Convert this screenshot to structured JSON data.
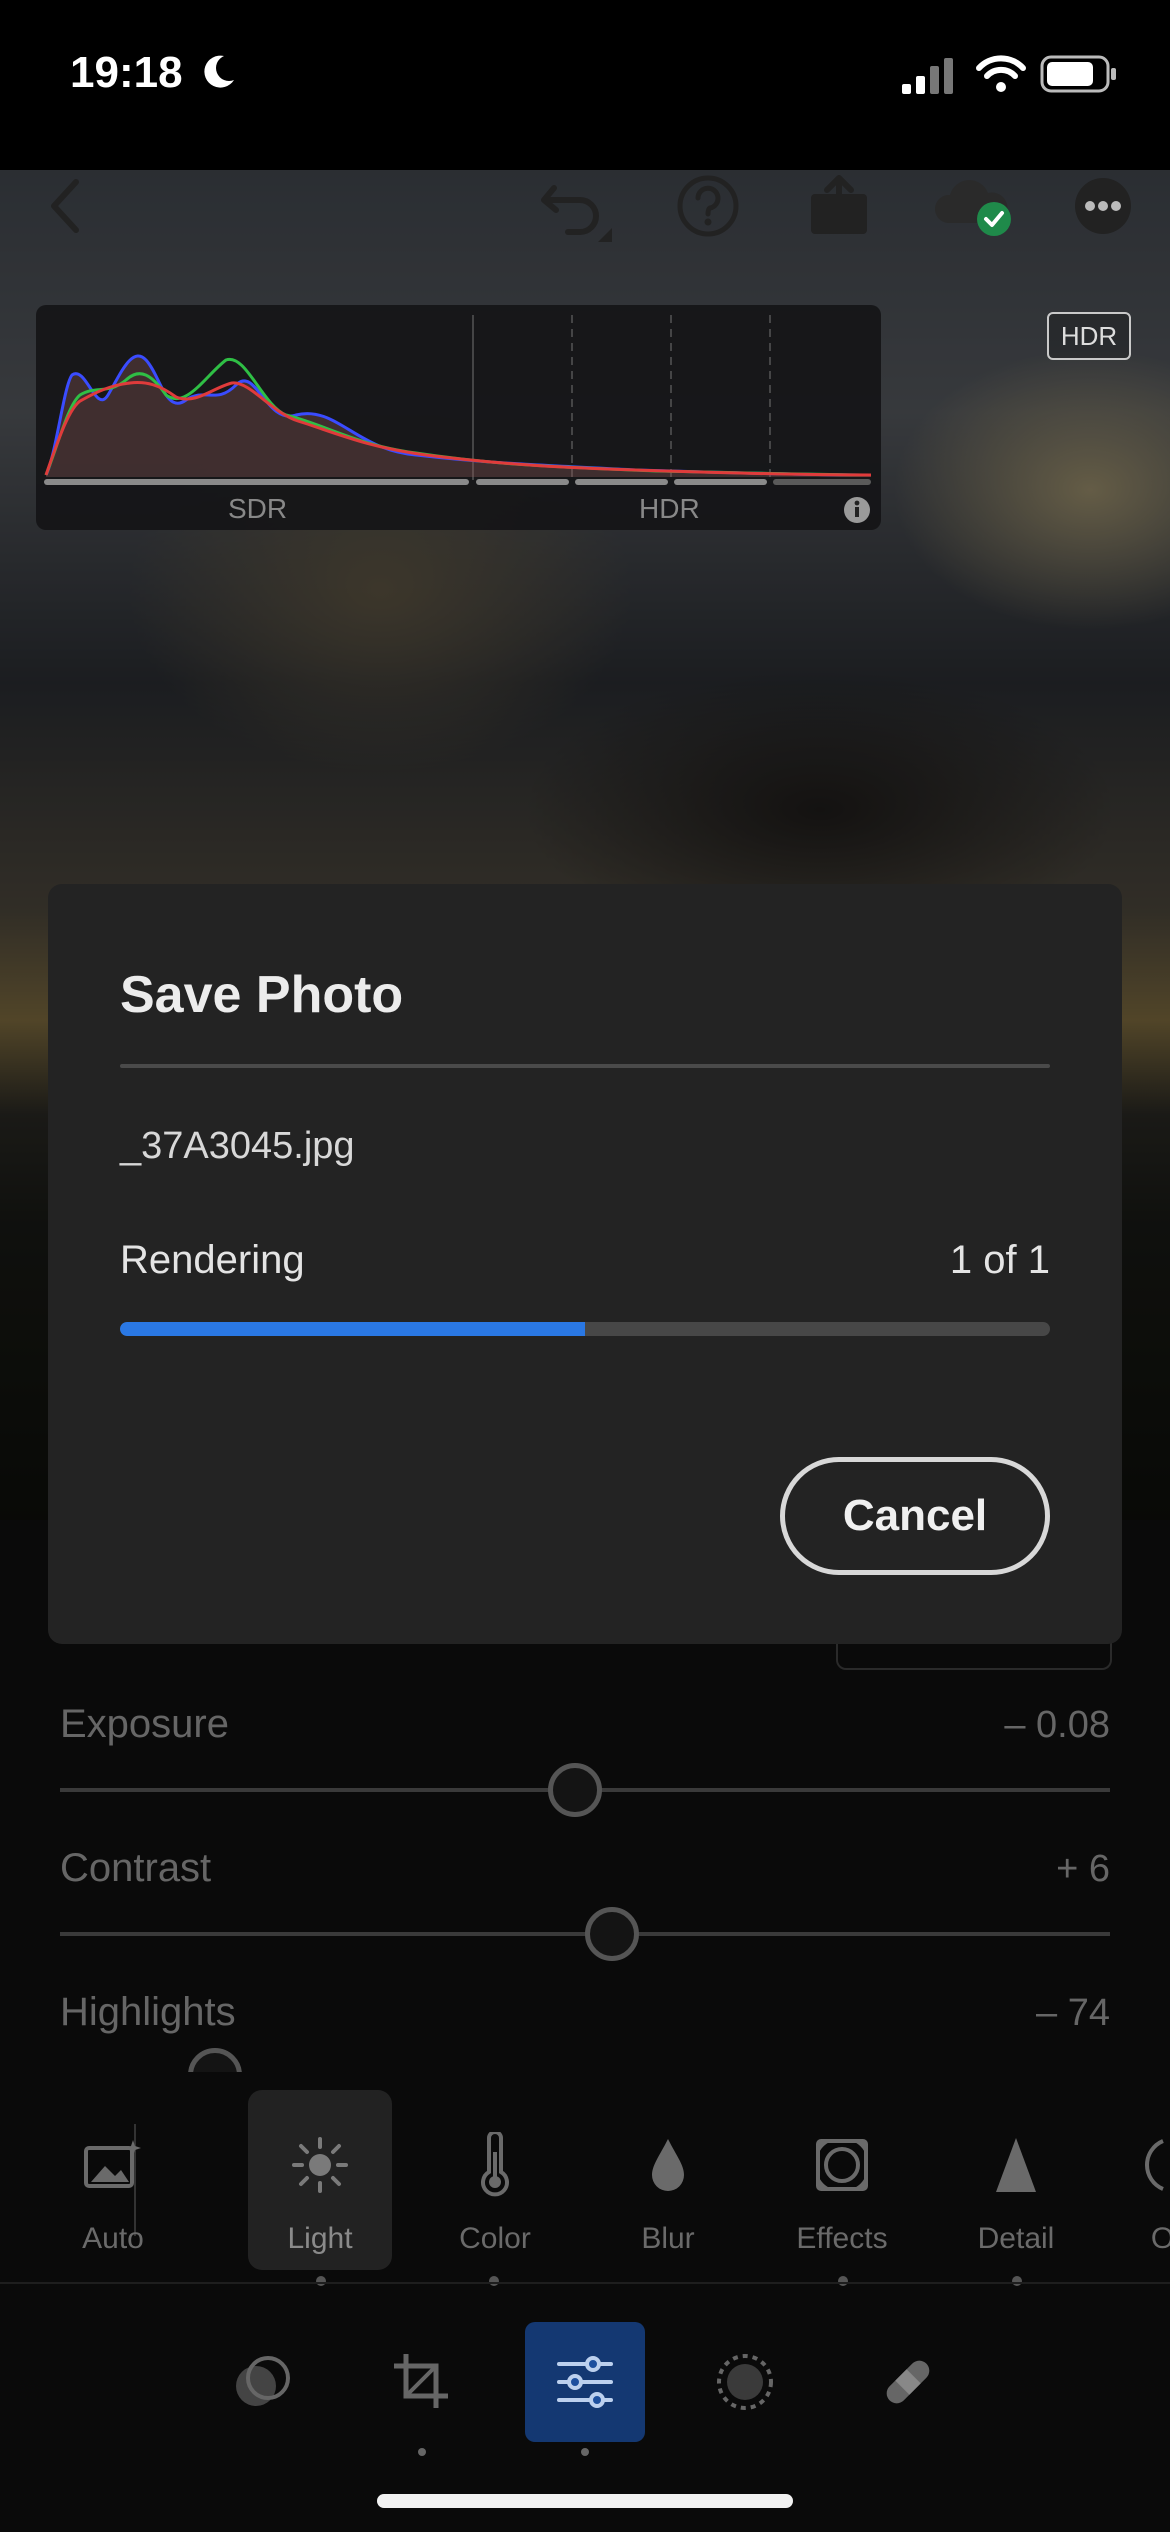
{
  "status_bar": {
    "time": "19:18"
  },
  "histogram": {
    "sdr_label": "SDR",
    "hdr_label": "HDR"
  },
  "hdr_badge": "HDR",
  "sliders": [
    {
      "label": "Exposure",
      "value": "– 0.08",
      "position": 0.49
    },
    {
      "label": "Contrast",
      "value": "+ 6",
      "position": 0.53
    },
    {
      "label": "Highlights",
      "value": "– 74",
      "position": 0.15
    }
  ],
  "tools": [
    {
      "label": "Auto",
      "icon": "auto-photo-icon"
    },
    {
      "label": "Light",
      "icon": "sun-icon",
      "active": true
    },
    {
      "label": "Color",
      "icon": "thermometer-icon"
    },
    {
      "label": "Blur",
      "icon": "drop-icon"
    },
    {
      "label": "Effects",
      "icon": "vignette-icon"
    },
    {
      "label": "Detail",
      "icon": "triangle-icon"
    },
    {
      "label": "O",
      "icon": "optics-icon"
    }
  ],
  "modes": [
    "presets-icon",
    "crop-icon",
    "edit-sliders-icon",
    "masking-icon",
    "healing-icon"
  ],
  "dialog": {
    "title": "Save Photo",
    "filename": "_37A3045.jpg",
    "status": "Rendering",
    "count": "1 of 1",
    "progress": 0.5,
    "cancel_label": "Cancel"
  },
  "colors": {
    "accent": "#2a78e4",
    "cloud_check": "#1f8a4a"
  }
}
